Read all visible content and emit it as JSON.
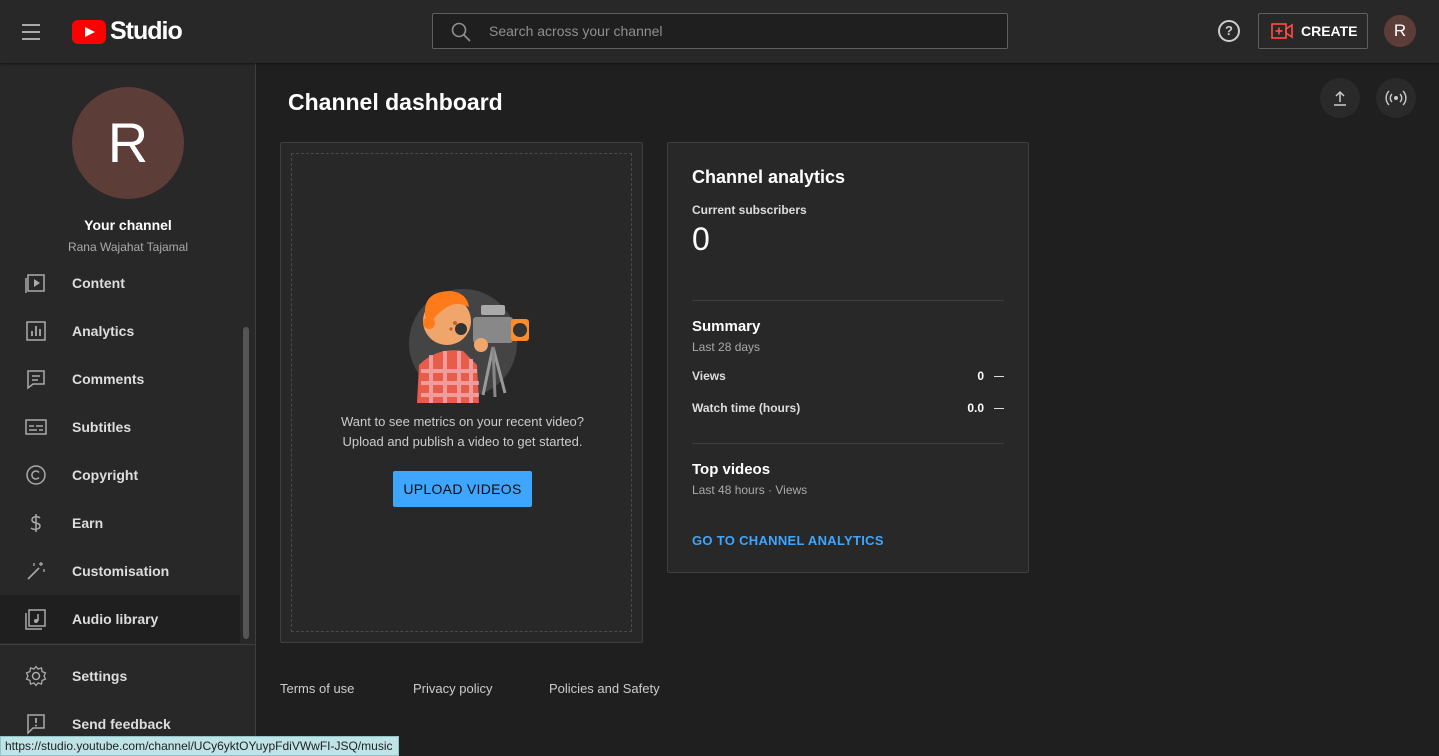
{
  "app": {
    "logo_text": "Studio"
  },
  "search": {
    "placeholder": "Search across your channel"
  },
  "header": {
    "help_label": "?",
    "create_label": "CREATE",
    "avatar_initial": "R"
  },
  "sidebar": {
    "avatar_initial": "R",
    "your_channel_label": "Your channel",
    "channel_name": "Rana Wajahat Tajamal",
    "items": [
      {
        "label": "Content",
        "icon": "content-icon"
      },
      {
        "label": "Analytics",
        "icon": "analytics-icon"
      },
      {
        "label": "Comments",
        "icon": "comments-icon"
      },
      {
        "label": "Subtitles",
        "icon": "subtitles-icon"
      },
      {
        "label": "Copyright",
        "icon": "copyright-icon"
      },
      {
        "label": "Earn",
        "icon": "earn-icon"
      },
      {
        "label": "Customisation",
        "icon": "customisation-icon"
      },
      {
        "label": "Audio library",
        "icon": "audio-library-icon",
        "active": true
      }
    ],
    "bottom_items": [
      {
        "label": "Settings",
        "icon": "gear-icon"
      },
      {
        "label": "Send feedback",
        "icon": "feedback-icon"
      }
    ]
  },
  "main": {
    "title": "Channel dashboard",
    "upload_card": {
      "line1": "Want to see metrics on your recent video?",
      "line2": "Upload and publish a video to get started.",
      "button_label": "UPLOAD VIDEOS"
    },
    "analytics_card": {
      "title": "Channel analytics",
      "subscribers_label": "Current subscribers",
      "subscribers_value": "0",
      "summary_title": "Summary",
      "summary_period": "Last 28 days",
      "metrics": [
        {
          "label": "Views",
          "value": "0"
        },
        {
          "label": "Watch time (hours)",
          "value": "0.0"
        }
      ],
      "top_videos_title": "Top videos",
      "top_videos_period": "Last 48 hours · Views",
      "link_label": "GO TO CHANNEL ANALYTICS"
    },
    "footer_links": [
      "Terms of use",
      "Privacy policy",
      "Policies and Safety"
    ]
  },
  "status_bar": {
    "url": "https://studio.youtube.com/channel/UCy6yktOYuypFdiVWwFI-JSQ/music"
  },
  "colors": {
    "accent": "#3ea6ff",
    "brand_red": "#ff0000",
    "avatar": "#5d3d37"
  }
}
